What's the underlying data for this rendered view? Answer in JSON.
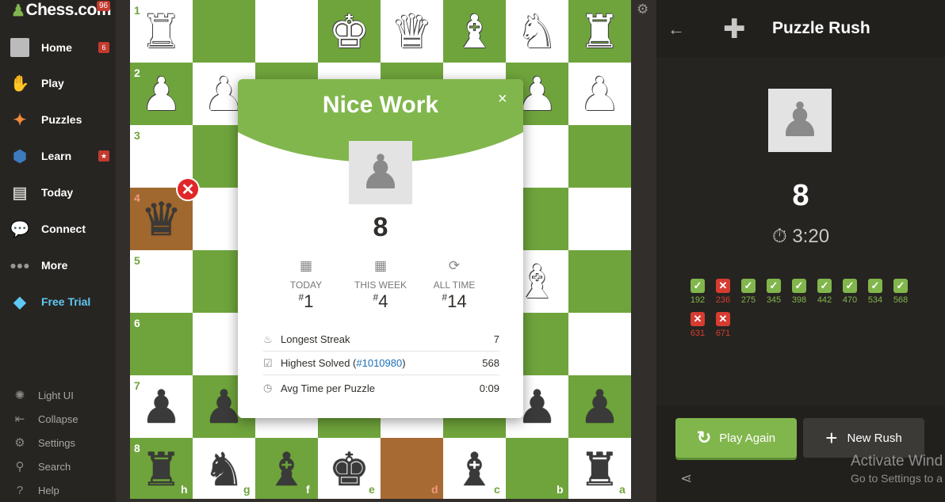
{
  "sidebar": {
    "logo": "Chess.com",
    "logo_badge": "96",
    "items": [
      {
        "label": "Home",
        "icon": "home-icon",
        "badge": "6"
      },
      {
        "label": "Play",
        "icon": "play-icon"
      },
      {
        "label": "Puzzles",
        "icon": "puzzle-icon"
      },
      {
        "label": "Learn",
        "icon": "learn-icon",
        "badge": "★"
      },
      {
        "label": "Today",
        "icon": "today-icon"
      },
      {
        "label": "Connect",
        "icon": "connect-icon"
      },
      {
        "label": "More",
        "icon": "more-icon"
      },
      {
        "label": "Free Trial",
        "icon": "diamond-icon"
      }
    ],
    "bottom": [
      {
        "label": "Light UI",
        "icon": "light-icon"
      },
      {
        "label": "Collapse",
        "icon": "collapse-icon"
      },
      {
        "label": "Settings",
        "icon": "gear-icon"
      },
      {
        "label": "Search",
        "icon": "search-icon"
      },
      {
        "label": "Help",
        "icon": "help-icon"
      }
    ]
  },
  "board": {
    "ranks": [
      "1",
      "2",
      "3",
      "4",
      "5",
      "6",
      "7",
      "8"
    ],
    "files": [
      "h",
      "g",
      "f",
      "e",
      "d",
      "c",
      "b",
      "a"
    ]
  },
  "modal": {
    "title": "Nice Work",
    "close": "×",
    "score": "8",
    "ranks": [
      {
        "label": "TODAY",
        "hash": "#",
        "value": "1"
      },
      {
        "label": "THIS WEEK",
        "hash": "#",
        "value": "4"
      },
      {
        "label": "ALL TIME",
        "hash": "#",
        "value": "14"
      }
    ],
    "stats": [
      {
        "label": "Longest Streak",
        "value": "7"
      },
      {
        "label": "Highest Solved (",
        "link": "#1010980",
        "label_end": ")",
        "value": "568"
      },
      {
        "label": "Avg Time per Puzzle",
        "value": "0:09"
      }
    ]
  },
  "panel": {
    "title": "Puzzle Rush",
    "score": "8",
    "timer": "3:20",
    "results": [
      {
        "ok": true,
        "rating": "192"
      },
      {
        "ok": false,
        "rating": "236"
      },
      {
        "ok": true,
        "rating": "275"
      },
      {
        "ok": true,
        "rating": "345"
      },
      {
        "ok": true,
        "rating": "398"
      },
      {
        "ok": true,
        "rating": "442"
      },
      {
        "ok": true,
        "rating": "470"
      },
      {
        "ok": true,
        "rating": "534"
      },
      {
        "ok": true,
        "rating": "568"
      },
      {
        "ok": false,
        "rating": "631"
      },
      {
        "ok": false,
        "rating": "671"
      }
    ],
    "play_again": "Play Again",
    "new_rush": "New Rush",
    "activate_line1": "Activate Wind",
    "activate_line2": "Go to Settings to a"
  },
  "colors": {
    "accent": "#81b64c",
    "dark_square": "#6fa43c",
    "error": "#d73c30"
  }
}
